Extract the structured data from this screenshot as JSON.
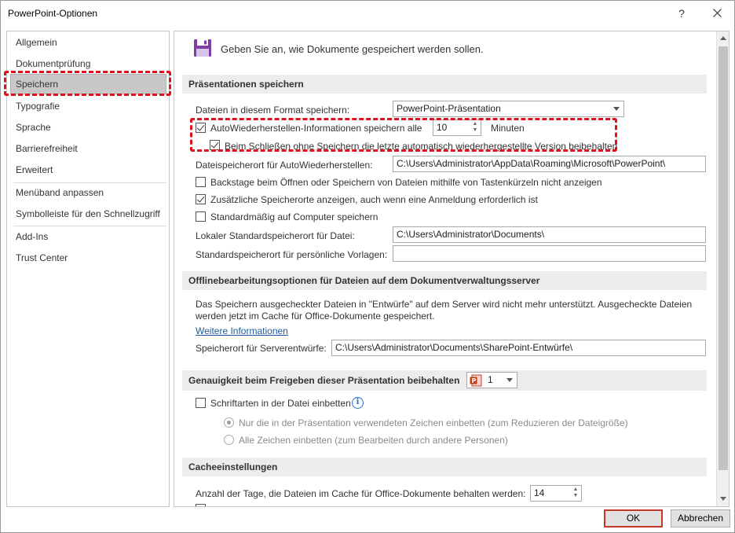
{
  "window": {
    "title": "PowerPoint-Optionen",
    "help_glyph": "?",
    "close_icon": "close-icon"
  },
  "nav": {
    "items": [
      {
        "label": "Allgemein"
      },
      {
        "label": "Dokumentprüfung"
      },
      {
        "label": "Speichern",
        "selected": true
      },
      {
        "label": "Typografie"
      },
      {
        "label": "Sprache"
      },
      {
        "label": "Barrierefreiheit"
      },
      {
        "label": "Erweitert"
      },
      {
        "label": "Menüband anpassen"
      },
      {
        "label": "Symbolleiste für den Schnellzugriff"
      },
      {
        "label": "Add-Ins"
      },
      {
        "label": "Trust Center"
      }
    ]
  },
  "header": {
    "text": "Geben Sie an, wie Dokumente gespeichert werden sollen.",
    "icon": "save-icon"
  },
  "save_section": {
    "title": "Präsentationen speichern",
    "format_label": "Dateien in diesem Format speichern:",
    "format_value": "PowerPoint-Präsentation",
    "autorecover_label": "AutoWiederherstellen-Informationen speichern alle",
    "autorecover_checked": true,
    "autorecover_minutes": "10",
    "minutes_label": "Minuten",
    "keep_last_label": "Beim Schließen ohne Speichern die letzte automatisch wiederhergestellte Version beibehalten",
    "keep_last_checked": true,
    "autorecover_location_label": "Dateispeicherort für AutoWiederherstellen:",
    "autorecover_location_value": "C:\\Users\\Administrator\\AppData\\Roaming\\Microsoft\\PowerPoint\\",
    "no_backstage_label": "Backstage beim Öffnen oder Speichern von Dateien mithilfe von Tastenkürzeln nicht anzeigen",
    "no_backstage_checked": false,
    "show_locations_label": "Zusätzliche Speicherorte anzeigen, auch wenn eine Anmeldung erforderlich ist",
    "show_locations_checked": true,
    "save_to_computer_label": "Standardmäßig auf Computer speichern",
    "save_to_computer_checked": false,
    "local_default_label": "Lokaler Standardspeicherort für Datei:",
    "local_default_value": "C:\\Users\\Administrator\\Documents\\",
    "personal_templates_label": "Standardspeicherort für persönliche Vorlagen:",
    "personal_templates_value": ""
  },
  "offline_section": {
    "title": "Offlinebearbeitungsoptionen für Dateien auf dem Dokumentverwaltungsserver",
    "info_line1": "Das Speichern ausgecheckter Dateien in \"Entwürfe\" auf dem Server wird nicht mehr unterstützt. Ausgecheckte Dateien",
    "info_line2": "werden jetzt im Cache für Office-Dokumente gespeichert.",
    "more_info_link": "Weitere Informationen",
    "server_drafts_label": "Speicherort für Serverentwürfe:",
    "server_drafts_value": "C:\\Users\\Administrator\\Documents\\SharePoint-Entwürfe\\"
  },
  "fidelity_section": {
    "title": "Genauigkeit beim Freigeben dieser Präsentation beibehalten",
    "presentation_value": "1",
    "embed_fonts_label": "Schriftarten in der Datei einbetten",
    "embed_fonts_checked": false,
    "embed_used_label": "Nur die in der Präsentation verwendeten Zeichen einbetten (zum Reduzieren der Dateigröße)",
    "embed_used_selected": true,
    "embed_all_label": "Alle Zeichen einbetten (zum Bearbeiten durch andere Personen)",
    "embed_all_selected": false
  },
  "cache_section": {
    "title": "Cacheeinstellungen",
    "days_label": "Anzahl der Tage, die Dateien im Cache für Office-Dokumente behalten werden:",
    "days_value": "14"
  },
  "buttons": {
    "ok": "OK",
    "cancel": "Abbrechen"
  }
}
